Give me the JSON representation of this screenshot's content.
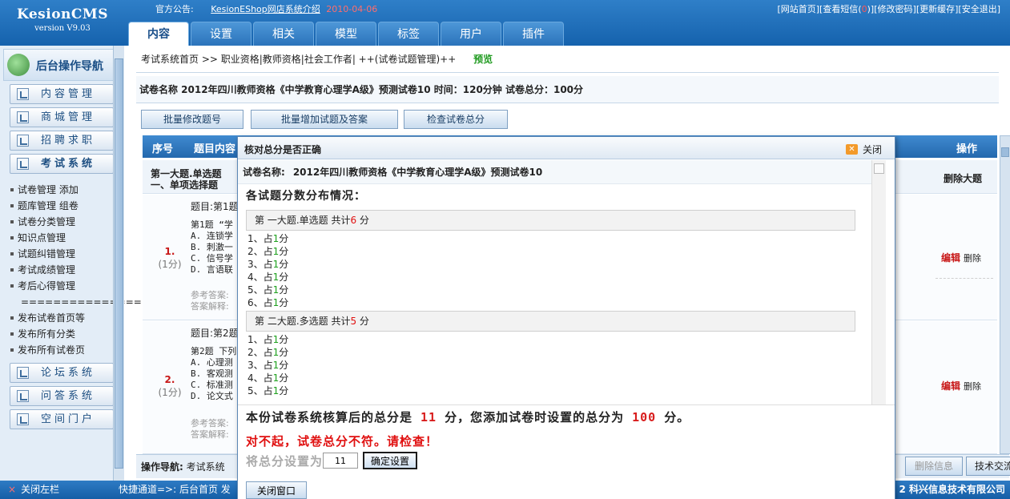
{
  "header": {
    "logo_title": "KesionCMS",
    "logo_version": "version V9.03",
    "notice_label": "官方公告:",
    "notice_link": "KesionEShop网店系统介绍",
    "notice_date": "2010-04-06",
    "links": {
      "site_home": "[网站首页]",
      "sms_pre": "[查看短信(",
      "sms_count": "0",
      "sms_post": ")]",
      "change_pwd": "[修改密码]",
      "update_cache": "[更新缓存]",
      "logout": "[安全退出]"
    },
    "tabs": [
      "内容",
      "设置",
      "相关",
      "模型",
      "标签",
      "用户",
      "插件"
    ]
  },
  "sidebar": {
    "title": "后台操作导航",
    "buttons_top": [
      "内容管理",
      "商城管理",
      "招聘求职",
      "考试系统"
    ],
    "exam_links": [
      "试卷管理  添加",
      "题库管理  组卷",
      "试卷分类管理",
      "知识点管理",
      "试题纠错管理",
      "考试成绩管理",
      "考后心得管理",
      "===================",
      "发布试卷首页等",
      "发布所有分类",
      "发布所有试卷页"
    ],
    "buttons_bottom": [
      "论坛系统",
      "问答系统",
      "空间门户"
    ]
  },
  "main": {
    "breadcrumb": "考试系统首页 >> 职业资格|教师资格|社会工作者| ++(试卷试题管理)++",
    "preview": "预览",
    "paper_info": "试卷名称  2012年四川教师资格《中学教育心理学A级》预测试卷10     时间：120分钟  试卷总分：100分",
    "buttons": [
      "批量修改题号",
      "批量增加试题及答案",
      "检查试卷总分"
    ],
    "table_headers": {
      "seq": "序号",
      "content": "题目内容",
      "ops": "操作"
    },
    "section": {
      "line1": "第一大题.单选题",
      "line2": "一、单项选择题",
      "delete": "删除大题"
    },
    "questions": [
      {
        "num": "1.",
        "score": "(1分)",
        "title": "题目:第1题",
        "lines": [
          "第1题 “学",
          "A. 连锁学",
          "B. 刺激一",
          "C. 信号学",
          "D. 言语联"
        ],
        "answers": [
          "参考答案:",
          "答案解释:"
        ],
        "edit": "编辑",
        "delete": "删除"
      },
      {
        "num": "2.",
        "score": "(1分)",
        "title": "题目:第2题",
        "lines": [
          "第2题 下列",
          "A. 心理测",
          "B. 客观测",
          "C. 标准测",
          "D. 论文式"
        ],
        "answers": [
          "参考答案:",
          "答案解释:"
        ],
        "edit": "编辑",
        "delete": "删除"
      }
    ],
    "op_nav": {
      "label": "操作导航:",
      "value": "考试系统"
    },
    "nav_buttons": [
      "删除信息",
      "技术交流"
    ]
  },
  "footer": {
    "close_left": "关闭左栏",
    "quick": "快捷通道=>:   后台首页   发",
    "copyright": "2  科兴信息技术有限公司"
  },
  "dialog": {
    "title": "核对总分是否正确",
    "close": "关闭",
    "paper_label": "试卷名称:",
    "paper_name": "2012年四川教师资格《中学教育心理学A级》预测试卷10",
    "dist_title": "各试题分数分布情况：",
    "sections": [
      {
        "head_pre": "第 一大题.单选题 共计",
        "head_num": "6",
        "head_post": " 分",
        "items": [
          {
            "pre": "1、占",
            "val": "1",
            "post": "分"
          },
          {
            "pre": "2、占",
            "val": "1",
            "post": "分"
          },
          {
            "pre": "3、占",
            "val": "1",
            "post": "分"
          },
          {
            "pre": "4、占",
            "val": "1",
            "post": "分"
          },
          {
            "pre": "5、占",
            "val": "1",
            "post": "分"
          },
          {
            "pre": "6、占",
            "val": "1",
            "post": "分"
          }
        ]
      },
      {
        "head_pre": "第 二大题.多选题 共计",
        "head_num": "5",
        "head_post": " 分",
        "items": [
          {
            "pre": "1、占",
            "val": "1",
            "post": "分"
          },
          {
            "pre": "2、占",
            "val": "1",
            "post": "分"
          },
          {
            "pre": "3、占",
            "val": "1",
            "post": "分"
          },
          {
            "pre": "4、占",
            "val": "1",
            "post": "分"
          },
          {
            "pre": "5、占",
            "val": "1",
            "post": "分"
          }
        ]
      }
    ],
    "summary": {
      "pre": "本份试卷系统核算后的总分是",
      "calc": "11",
      "mid": "分，您添加试卷时设置的总分为",
      "set": "100",
      "post": "分。"
    },
    "warning": "对不起，试卷总分不符。请检查！",
    "set_label": "将总分设置为",
    "input_value": "11",
    "confirm": "确定设置",
    "close_window": "关闭窗口"
  }
}
